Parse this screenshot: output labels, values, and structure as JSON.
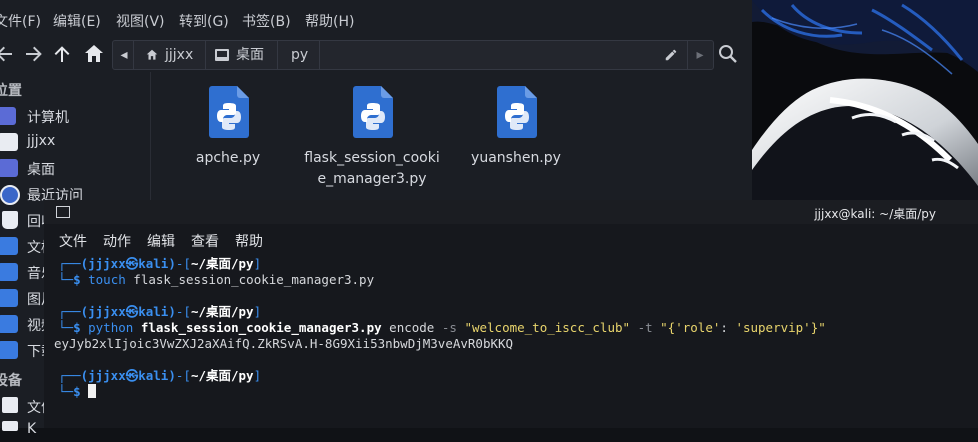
{
  "file_manager": {
    "menu": [
      "文件(F)",
      "编辑(E)",
      "视图(V)",
      "转到(G)",
      "书签(B)",
      "帮助(H)"
    ],
    "breadcrumbs": [
      "jjjxx",
      "桌面",
      "py"
    ],
    "sidebar": {
      "places_header": "位置",
      "items": [
        {
          "label": "计算机",
          "icon": "computer-icon",
          "color": "#5b6bd6"
        },
        {
          "label": "jjjxx",
          "icon": "home-folder-icon",
          "color": "#e9ecf2"
        },
        {
          "label": "桌面",
          "icon": "desktop-icon",
          "color": "#5b6bd6"
        },
        {
          "label": "最近访问",
          "icon": "recent-icon",
          "color": "#3a66c8"
        },
        {
          "label": "回收站",
          "icon": "trash-icon",
          "color": "#e9ecf2"
        },
        {
          "label": "文档",
          "icon": "documents-folder-icon",
          "color": "#3a7be0"
        },
        {
          "label": "音乐",
          "icon": "music-folder-icon",
          "color": "#3a7be0"
        },
        {
          "label": "图片",
          "icon": "pictures-folder-icon",
          "color": "#3a7be0"
        },
        {
          "label": "视频",
          "icon": "videos-folder-icon",
          "color": "#3a7be0"
        },
        {
          "label": "下载",
          "icon": "downloads-folder-icon",
          "color": "#3a7be0"
        }
      ],
      "devices_header": "设备",
      "devices": [
        {
          "label": "文件系统",
          "icon": "drive-icon"
        },
        {
          "label": "K",
          "icon": "drive-icon"
        }
      ]
    },
    "files": [
      {
        "name": "apche.py",
        "icon": "python-file-icon"
      },
      {
        "name": "flask_session_cookie_manager3.py",
        "display": "flask_session_cooki\ne_manager3.py",
        "icon": "python-file-icon"
      },
      {
        "name": "yuanshen.py",
        "icon": "python-file-icon"
      }
    ]
  },
  "terminal": {
    "title": "jjjxx@kali: ~/桌面/py",
    "menu": [
      "文件",
      "动作",
      "编辑",
      "查看",
      "帮助"
    ],
    "prompt": {
      "user_host": "(jjjxx㉿kali)",
      "path": "~/桌面/py",
      "dollar": "$"
    },
    "commands": [
      {
        "cmd": "touch",
        "args": " flask_session_cookie_manager3.py"
      },
      {
        "cmd": "python",
        "script": "flask_session_cookie_manager3.py",
        "subcmd": " encode ",
        "flag_s": "-s",
        "secret": "\"welcome_to_iscc_club\"",
        "flag_t": "-t",
        "payload_open": "\"{",
        "payload_key": "'role'",
        "payload_colon": ": ",
        "payload_val": "'supervip'",
        "payload_close": "}\""
      }
    ],
    "output": "eyJyb2xlIjoic3VwZXJ2aXAifQ.ZkRSvA.H-8G9Xii53nbwDjM3veAvR0bKKQ"
  },
  "colors": {
    "prompt_blue": "#3a8ff0",
    "string_yellow": "#e8d46c",
    "terminal_bg": "#16181d",
    "fm_bg": "#1b1e24"
  }
}
